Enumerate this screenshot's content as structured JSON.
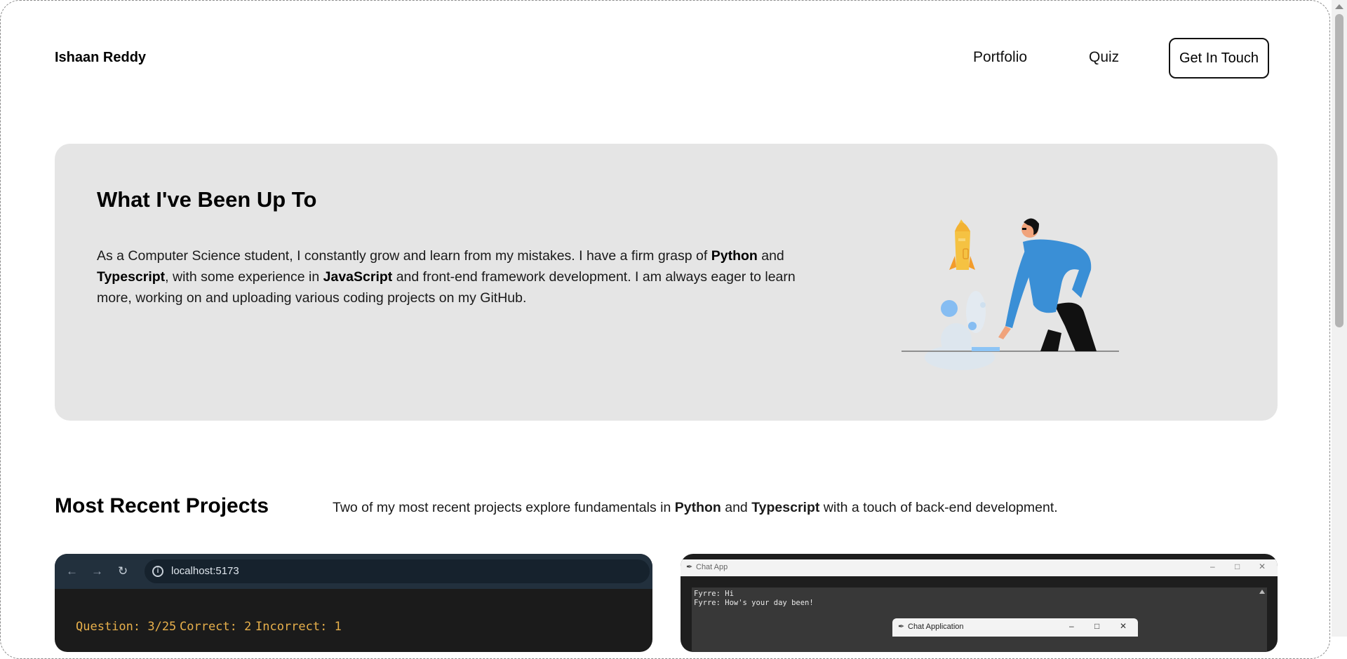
{
  "header": {
    "brand": "Ishaan Reddy",
    "nav": {
      "portfolio": "Portfolio",
      "quiz": "Quiz"
    },
    "cta_label": "Get In Touch"
  },
  "hero": {
    "title": "What I've Been Up To",
    "text": {
      "p1": "As a Computer Science student, I constantly grow and learn from my mistakes. I have a firm grasp of ",
      "b1": "Python",
      "p2": " and ",
      "b2": "Typescript",
      "p3": ", with some experience in ",
      "b3": "JavaScript",
      "p4": " and front-end framework development. I am always eager to learn more, working on and uploading various coding projects on my GitHub."
    }
  },
  "projects": {
    "title": "Most Recent Projects",
    "desc": {
      "p1": "Two of my most recent projects explore fundamentals in ",
      "b1": "Python",
      "p2": " and ",
      "b2": "Typescript",
      "p3": " with a touch of back-end development."
    },
    "card1": {
      "url": "localhost:5173",
      "question": "Question: 3/25",
      "correct": "Correct: 2",
      "incorrect": "Incorrect: 1"
    },
    "card2": {
      "window_title": "Chat App",
      "lines": [
        "Fyrre: Hi",
        "Fyrre: How's your day been!"
      ],
      "sub_window_title": "Chat Application"
    }
  },
  "colors": {
    "hero_bg": "#e5e5e5",
    "quiz_text": "#e8b04b",
    "figure_shirt": "#3a8fd6",
    "rocket": "#f5c242"
  }
}
